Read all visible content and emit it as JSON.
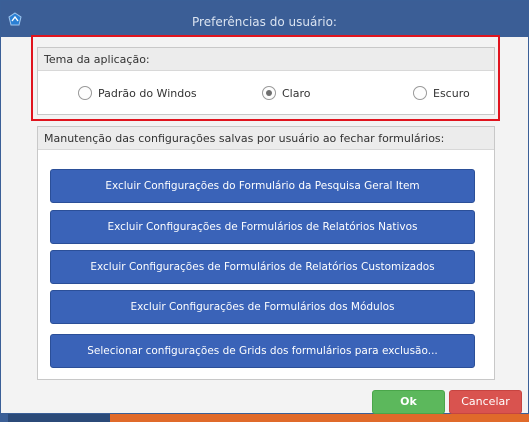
{
  "window": {
    "title": "Preferências do usuário:"
  },
  "theme": {
    "header": "Tema da aplicação:",
    "options": [
      {
        "label": "Padrão do Windos",
        "selected": false
      },
      {
        "label": "Claro",
        "selected": true
      },
      {
        "label": "Escuro",
        "selected": false
      }
    ]
  },
  "maintenance": {
    "header": "Manutenção das configurações salvas por usuário ao fechar formulários:",
    "buttons": [
      "Excluir Configurações do Formulário da Pesquisa Geral Item",
      "Excluir Configurações de Formulários de Relatórios Nativos",
      "Excluir Configurações de Formulários de Relatórios Customizados",
      "Excluir Configurações de Formulários dos Módulos",
      "Selecionar configurações de Grids dos formulários para exclusão..."
    ]
  },
  "footer": {
    "ok_label": "Ok",
    "cancel_label": "Cancelar"
  },
  "colors": {
    "titlebar": "#3b5e96",
    "action_button": "#3a63b8",
    "ok": "#5cb85c",
    "cancel": "#d9534f",
    "highlight": "#e0141e"
  }
}
